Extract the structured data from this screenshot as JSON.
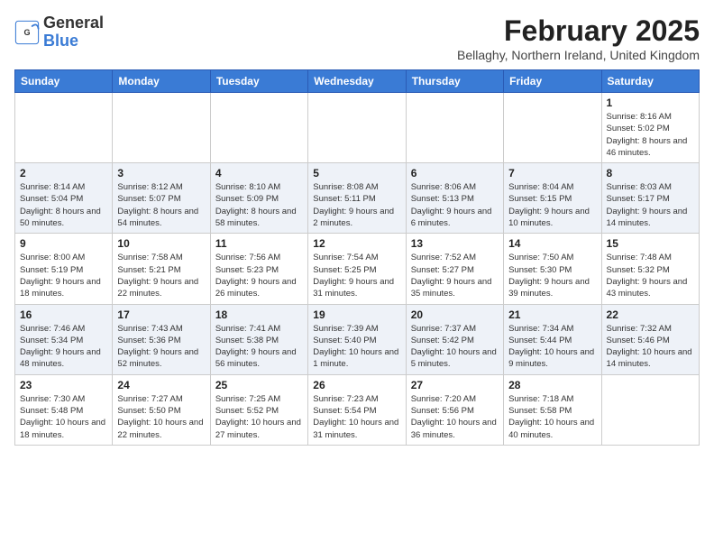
{
  "title": "February 2025",
  "location": "Bellaghy, Northern Ireland, United Kingdom",
  "logo": {
    "general": "General",
    "blue": "Blue"
  },
  "days_of_week": [
    "Sunday",
    "Monday",
    "Tuesday",
    "Wednesday",
    "Thursday",
    "Friday",
    "Saturday"
  ],
  "weeks": [
    [
      {
        "day": "",
        "info": ""
      },
      {
        "day": "",
        "info": ""
      },
      {
        "day": "",
        "info": ""
      },
      {
        "day": "",
        "info": ""
      },
      {
        "day": "",
        "info": ""
      },
      {
        "day": "",
        "info": ""
      },
      {
        "day": "1",
        "info": "Sunrise: 8:16 AM\nSunset: 5:02 PM\nDaylight: 8 hours and 46 minutes."
      }
    ],
    [
      {
        "day": "2",
        "info": "Sunrise: 8:14 AM\nSunset: 5:04 PM\nDaylight: 8 hours and 50 minutes."
      },
      {
        "day": "3",
        "info": "Sunrise: 8:12 AM\nSunset: 5:07 PM\nDaylight: 8 hours and 54 minutes."
      },
      {
        "day": "4",
        "info": "Sunrise: 8:10 AM\nSunset: 5:09 PM\nDaylight: 8 hours and 58 minutes."
      },
      {
        "day": "5",
        "info": "Sunrise: 8:08 AM\nSunset: 5:11 PM\nDaylight: 9 hours and 2 minutes."
      },
      {
        "day": "6",
        "info": "Sunrise: 8:06 AM\nSunset: 5:13 PM\nDaylight: 9 hours and 6 minutes."
      },
      {
        "day": "7",
        "info": "Sunrise: 8:04 AM\nSunset: 5:15 PM\nDaylight: 9 hours and 10 minutes."
      },
      {
        "day": "8",
        "info": "Sunrise: 8:03 AM\nSunset: 5:17 PM\nDaylight: 9 hours and 14 minutes."
      }
    ],
    [
      {
        "day": "9",
        "info": "Sunrise: 8:00 AM\nSunset: 5:19 PM\nDaylight: 9 hours and 18 minutes."
      },
      {
        "day": "10",
        "info": "Sunrise: 7:58 AM\nSunset: 5:21 PM\nDaylight: 9 hours and 22 minutes."
      },
      {
        "day": "11",
        "info": "Sunrise: 7:56 AM\nSunset: 5:23 PM\nDaylight: 9 hours and 26 minutes."
      },
      {
        "day": "12",
        "info": "Sunrise: 7:54 AM\nSunset: 5:25 PM\nDaylight: 9 hours and 31 minutes."
      },
      {
        "day": "13",
        "info": "Sunrise: 7:52 AM\nSunset: 5:27 PM\nDaylight: 9 hours and 35 minutes."
      },
      {
        "day": "14",
        "info": "Sunrise: 7:50 AM\nSunset: 5:30 PM\nDaylight: 9 hours and 39 minutes."
      },
      {
        "day": "15",
        "info": "Sunrise: 7:48 AM\nSunset: 5:32 PM\nDaylight: 9 hours and 43 minutes."
      }
    ],
    [
      {
        "day": "16",
        "info": "Sunrise: 7:46 AM\nSunset: 5:34 PM\nDaylight: 9 hours and 48 minutes."
      },
      {
        "day": "17",
        "info": "Sunrise: 7:43 AM\nSunset: 5:36 PM\nDaylight: 9 hours and 52 minutes."
      },
      {
        "day": "18",
        "info": "Sunrise: 7:41 AM\nSunset: 5:38 PM\nDaylight: 9 hours and 56 minutes."
      },
      {
        "day": "19",
        "info": "Sunrise: 7:39 AM\nSunset: 5:40 PM\nDaylight: 10 hours and 1 minute."
      },
      {
        "day": "20",
        "info": "Sunrise: 7:37 AM\nSunset: 5:42 PM\nDaylight: 10 hours and 5 minutes."
      },
      {
        "day": "21",
        "info": "Sunrise: 7:34 AM\nSunset: 5:44 PM\nDaylight: 10 hours and 9 minutes."
      },
      {
        "day": "22",
        "info": "Sunrise: 7:32 AM\nSunset: 5:46 PM\nDaylight: 10 hours and 14 minutes."
      }
    ],
    [
      {
        "day": "23",
        "info": "Sunrise: 7:30 AM\nSunset: 5:48 PM\nDaylight: 10 hours and 18 minutes."
      },
      {
        "day": "24",
        "info": "Sunrise: 7:27 AM\nSunset: 5:50 PM\nDaylight: 10 hours and 22 minutes."
      },
      {
        "day": "25",
        "info": "Sunrise: 7:25 AM\nSunset: 5:52 PM\nDaylight: 10 hours and 27 minutes."
      },
      {
        "day": "26",
        "info": "Sunrise: 7:23 AM\nSunset: 5:54 PM\nDaylight: 10 hours and 31 minutes."
      },
      {
        "day": "27",
        "info": "Sunrise: 7:20 AM\nSunset: 5:56 PM\nDaylight: 10 hours and 36 minutes."
      },
      {
        "day": "28",
        "info": "Sunrise: 7:18 AM\nSunset: 5:58 PM\nDaylight: 10 hours and 40 minutes."
      },
      {
        "day": "",
        "info": ""
      }
    ]
  ]
}
